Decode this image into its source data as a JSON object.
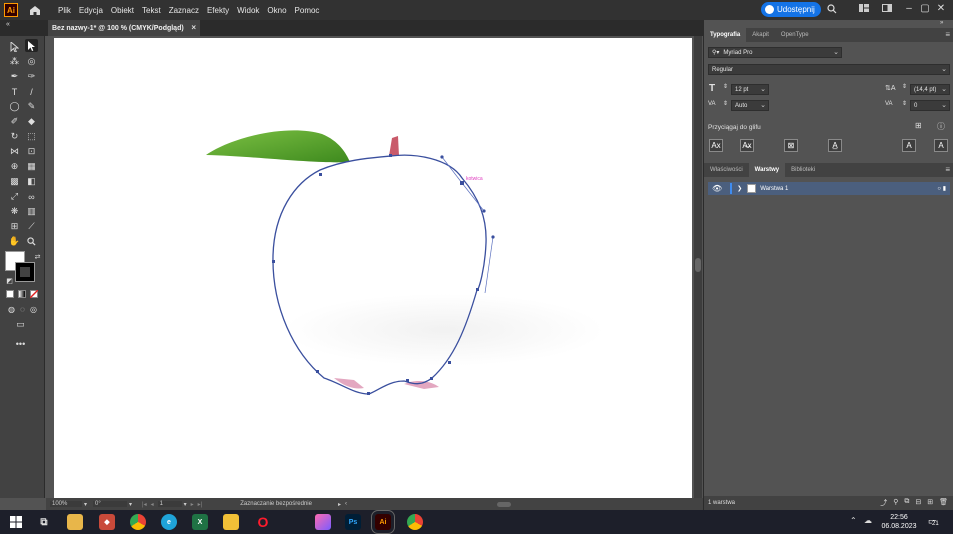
{
  "menubar": {
    "logo": "Ai",
    "items": [
      "Plik",
      "Edycja",
      "Obiekt",
      "Tekst",
      "Zaznacz",
      "Efekty",
      "Widok",
      "Okno",
      "Pomoc"
    ],
    "share_label": "Udostępnij"
  },
  "document": {
    "tab_title": "Bez nazwy-1* @ 100 % (CMYK/Podgląd)",
    "close": "×"
  },
  "canvas": {
    "anchor_hint": "kotwica",
    "colors": {
      "path": "#3a4f9e",
      "leaf": "#5aa22b",
      "stem": "#c0405a",
      "hint": "#e040c0"
    }
  },
  "statusbar": {
    "zoom": "100%",
    "rotation": "0°",
    "artboard_number": "1",
    "tool_status": "Zaznaczanie bezpośrednie"
  },
  "typography_panel": {
    "tabs": [
      "Typografia",
      "Akapit",
      "OpenType"
    ],
    "font_family": "Myriad Pro",
    "font_style": "Regular",
    "font_size": "12 pt",
    "leading": "(14,4 pt)",
    "kerning": "Auto",
    "tracking": "0",
    "snap_label": "Przyciągaj do glifu"
  },
  "layers_panel": {
    "tabs": [
      "Właściwości",
      "Warstwy",
      "Biblioteki"
    ],
    "layers": [
      {
        "name": "Warstwa 1"
      }
    ],
    "footer_label": "1 warstwa"
  },
  "taskbar": {
    "time": "22:56",
    "date": "06.08.2023",
    "notification_count": "21",
    "apps": [
      "file-explorer",
      "task-view",
      "folder",
      "apple-app",
      "chrome",
      "edge",
      "excel",
      "notes",
      "opera",
      "photos",
      "photoshop",
      "illustrator",
      "chrome-2"
    ]
  }
}
